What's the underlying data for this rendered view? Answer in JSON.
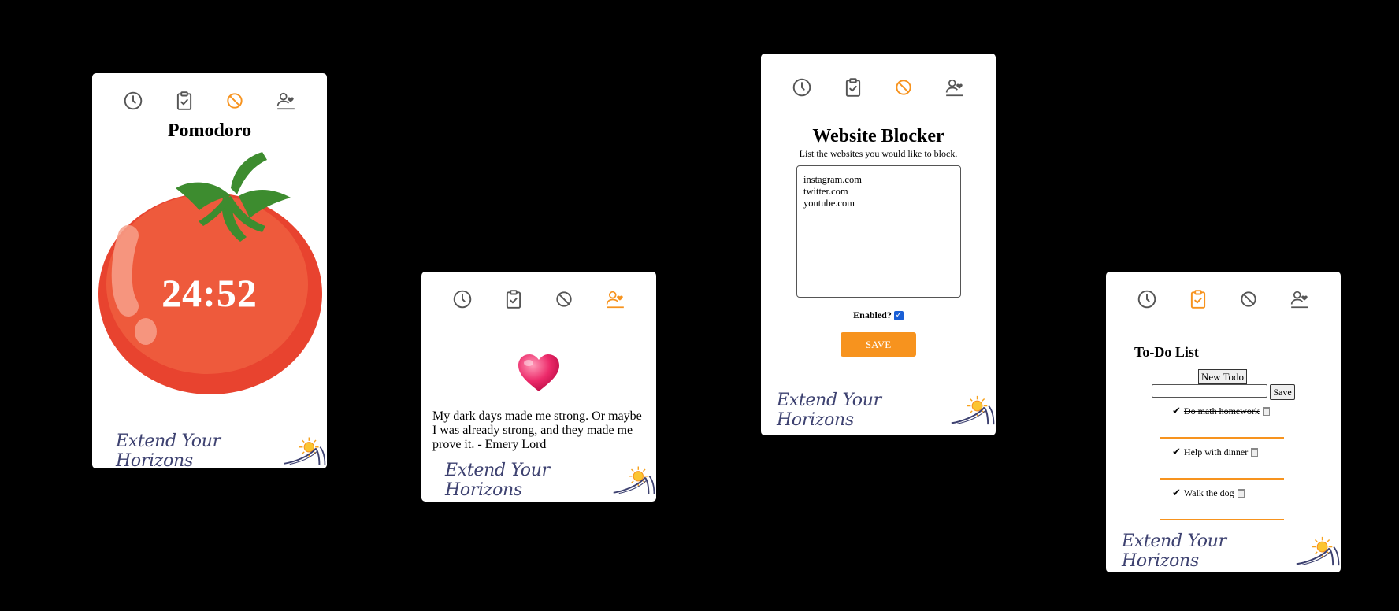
{
  "colors": {
    "accent": "#f7931e",
    "icon_gray": "#555555",
    "brand_navy": "#3d4170",
    "background": "#000000"
  },
  "nav_icons": [
    "clock-icon",
    "clipboard-check-icon",
    "block-icon",
    "user-heart-icon"
  ],
  "brand": {
    "text": "Extend Your Horizons"
  },
  "pomodoro": {
    "title": "Pomodoro",
    "timer": "24:52",
    "active_tab": "block-icon"
  },
  "quote": {
    "text": "My dark days made me strong. Or maybe I was already strong, and they made me prove it. - Emery Lord",
    "active_tab": "user-heart-icon"
  },
  "blocker": {
    "title": "Website Blocker",
    "subtitle": "List the websites you would like to block.",
    "sites": "instagram.com\ntwitter.com\nyoutube.com",
    "enabled_label": "Enabled?",
    "enabled": true,
    "save_label": "SAVE",
    "active_tab": "block-icon"
  },
  "todo": {
    "title": "To-Do List",
    "new_button": "New Todo",
    "save_button": "Save",
    "input_value": "",
    "items": [
      {
        "text": "Do math homework",
        "done": true
      },
      {
        "text": "Help with dinner",
        "done": false
      },
      {
        "text": "Walk the dog",
        "done": false
      }
    ],
    "active_tab": "clipboard-check-icon"
  }
}
